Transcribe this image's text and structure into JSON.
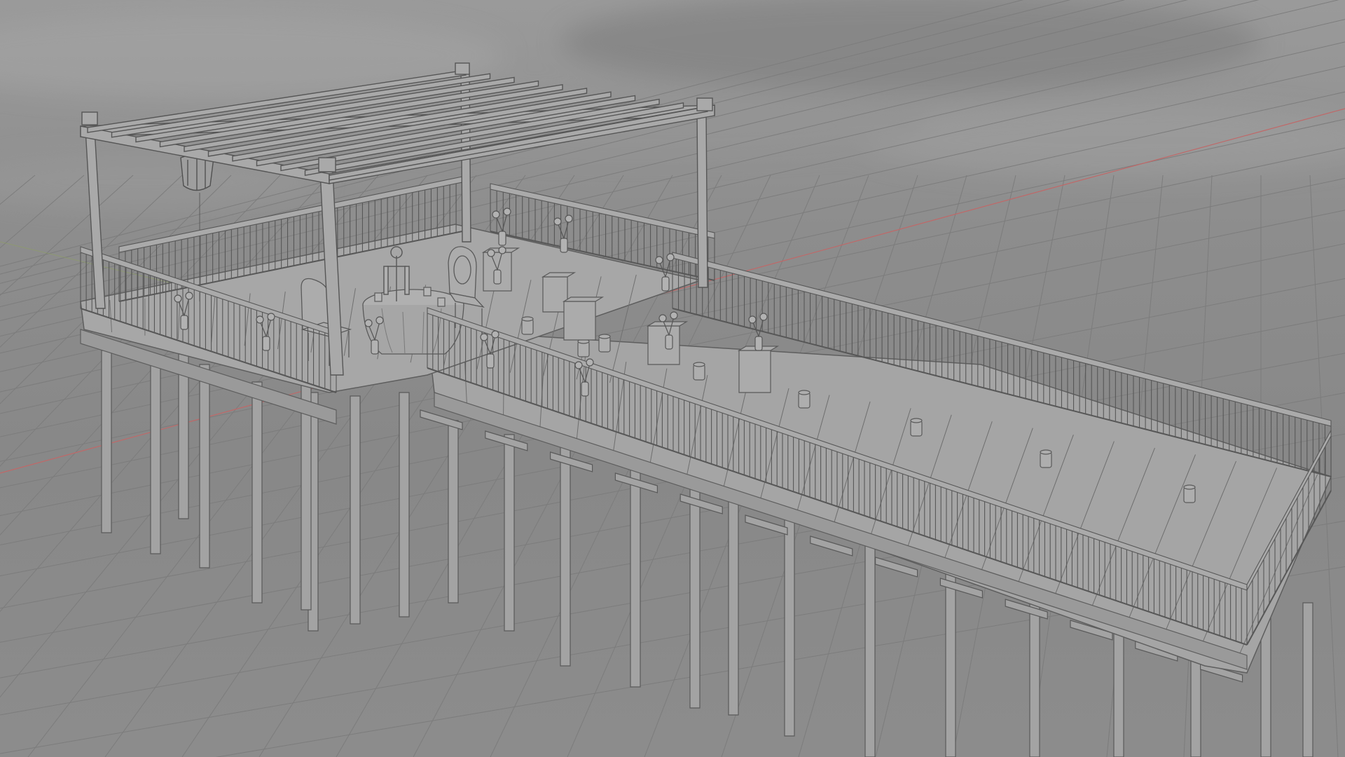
{
  "viewport": {
    "mode": "solid-shading",
    "background_color": "#8c8c8c",
    "grid_color": "#7e7e7e",
    "x_axis_color": "#c06060",
    "y_axis_color": "#8aa060",
    "model_color": "#a9a9a9",
    "model_edge_color": "#5a5a5a"
  },
  "scene": {
    "objects": [
      "pergola",
      "railing",
      "pier-deck",
      "dining-table",
      "chair",
      "flower-vase",
      "lantern",
      "pedestal",
      "candle",
      "support-piling"
    ]
  }
}
